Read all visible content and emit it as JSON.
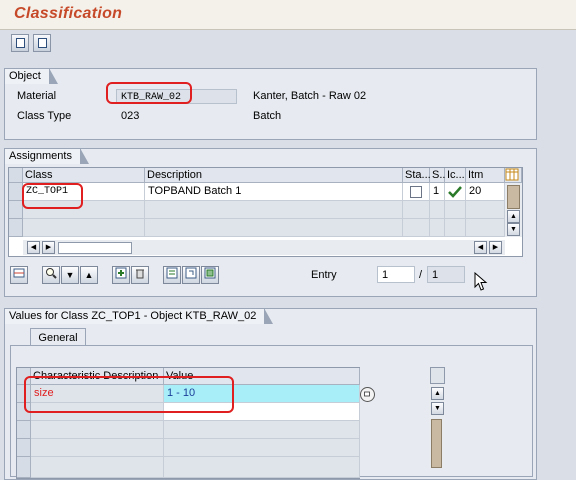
{
  "window": {
    "title": "Classification"
  },
  "object_group": {
    "title": "Object",
    "material_label": "Material",
    "material_value": "KTB_RAW_02",
    "material_desc": "Kanter, Batch - Raw 02",
    "class_type_label": "Class Type",
    "class_type_value": "023",
    "class_type_desc": "Batch"
  },
  "assignments": {
    "title": "Assignments",
    "columns": [
      "Class",
      "Description",
      "Sta...",
      "S...",
      "Ic...",
      "Itm"
    ],
    "rows": [
      {
        "class": "ZC_TOP1",
        "description": "TOPBAND Batch 1",
        "status": "1",
        "item": "20"
      }
    ],
    "entry_label": "Entry",
    "entry_value": "1",
    "entry_sep": "/",
    "entry_total": "1"
  },
  "values": {
    "title": "Values for Class ZC_TOP1 - Object KTB_RAW_02",
    "tab_label": "General",
    "columns": [
      "Characteristic Description",
      "Value"
    ],
    "rows": [
      {
        "characteristic": "size",
        "value": "1 - 10"
      }
    ]
  },
  "colors": {
    "title": "#c64a2a",
    "highlight": "#e02020",
    "value_cell": "#a8eef8",
    "check": "#2a7a2a"
  },
  "icons": [
    "save-variant-icon",
    "print-variant-icon",
    "insert-line-icon",
    "search-icon",
    "arrow-down-icon",
    "arrow-up-icon",
    "add-icon",
    "delete-icon",
    "details-icon",
    "overview-icon",
    "other-object-icon",
    "check-icon",
    "table-settings-icon",
    "value-help-icon"
  ]
}
